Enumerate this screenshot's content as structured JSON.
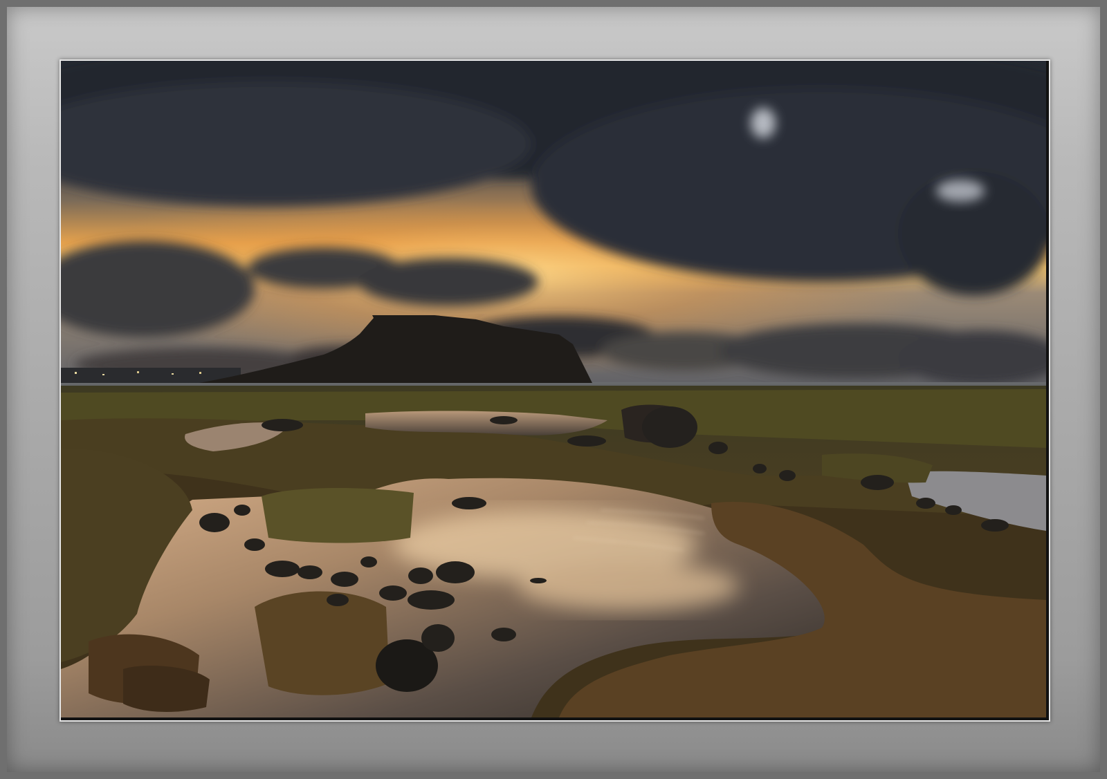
{
  "frame": {
    "border_color": "#6f6f6f",
    "mat_color": "#b9b9b9",
    "edge_color": "#e8e8e8"
  },
  "photo": {
    "scene": [
      "sunset-sky",
      "storm-clouds",
      "headland",
      "ocean",
      "tide-pools",
      "mossy-rocks"
    ],
    "colors": {
      "cloud_dark": "#2b2f38",
      "sky_glow": "#e9a24a",
      "sky_pale": "#f3d08a",
      "headland": "#1f1c19",
      "moss": "#5e5424",
      "rock_brown": "#4a3520",
      "water_reflect": "#c9a27a"
    }
  }
}
